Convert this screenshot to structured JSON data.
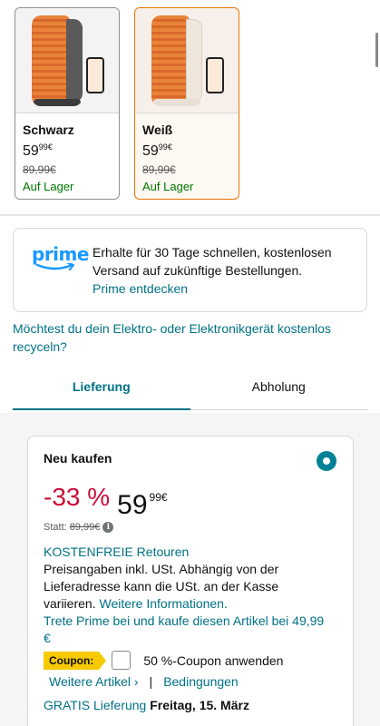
{
  "variants": [
    {
      "name": "Schwarz",
      "price_whole": "59",
      "price_frac": "99",
      "currency": "€",
      "old_price": "89,99€",
      "stock": "Auf Lager",
      "selected": false
    },
    {
      "name": "Weiß",
      "price_whole": "59",
      "price_frac": "99",
      "currency": "€",
      "old_price": "89,99€",
      "stock": "Auf Lager",
      "selected": true
    }
  ],
  "prime": {
    "logo": "prime",
    "text": "Erhalte für 30 Tage schnellen, kostenlosen Versand auf zukünftige Bestellungen.",
    "link": "Prime entdecken"
  },
  "recycle_link": "Möchtest du dein Elektro- oder Elektronikgerät kostenlos recyceln?",
  "tabs": [
    {
      "label": "Lieferung",
      "active": true
    },
    {
      "label": "Abholung",
      "active": false
    }
  ],
  "offer": {
    "title": "Neu kaufen",
    "discount": "-33 %",
    "price_whole": "59",
    "price_frac": "99",
    "currency": "€",
    "statt_label": "Statt:",
    "old_price": "89,99€",
    "returns_link": "KOSTENFREIE Retouren",
    "vat_text": "Preisangaben inkl. USt. Abhängig von der Lieferadresse kann die USt. an der Kasse variieren.",
    "more_info_link": "Weitere Informationen.",
    "prime_offer": "Trete Prime bei und kaufe diesen Artikel bei 49,99 €",
    "coupon_tag": "Coupon:",
    "coupon_label": "50 %-Coupon anwenden",
    "more_items_link": "Weitere Artikel ›",
    "separator": "|",
    "conditions_link": "Bedingungen",
    "delivery_prefix": "GRATIS Lieferung",
    "delivery_date": "Freitag, 15. März"
  },
  "colors": {
    "link": "#007185",
    "discount": "#cc0c39",
    "stock": "#007600",
    "selected_border": "#e77600",
    "coupon": "#f7ca00",
    "radio": "#008296"
  }
}
